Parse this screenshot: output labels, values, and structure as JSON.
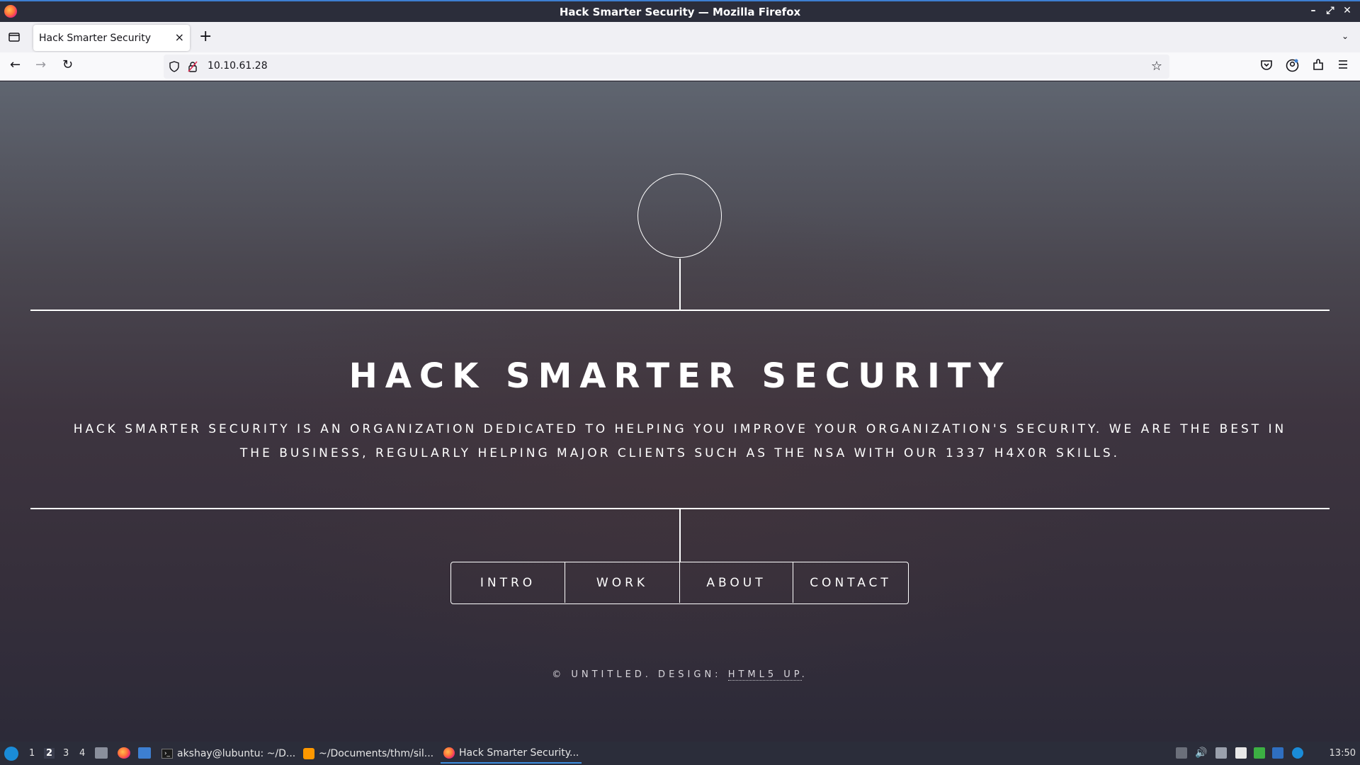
{
  "window": {
    "title": "Hack Smarter Security — Mozilla Firefox"
  },
  "tabs": [
    {
      "label": "Hack Smarter Security",
      "active": true
    }
  ],
  "navbar": {
    "url": "10.10.61.28"
  },
  "site": {
    "title": "HACK SMARTER SECURITY",
    "description": "Hack Smarter Security is an organization dedicated to helping you improve your organization's security. We are the best in the business, regularly helping major clients such as the NSA with our 1337 H4x0r skills.",
    "nav": [
      "INTRO",
      "WORK",
      "ABOUT",
      "CONTACT"
    ],
    "footer_prefix": "© UNTITLED. DESIGN: ",
    "footer_link": "HTML5 UP",
    "footer_suffix": "."
  },
  "taskbar": {
    "workspaces": [
      "1",
      "2",
      "3",
      "4"
    ],
    "active_workspace": "2",
    "tasks": [
      {
        "label": "akshay@lubuntu: ~/D...",
        "icon": "terminal-icon"
      },
      {
        "label": "~/Documents/thm/sil...",
        "icon": "sublime-text-icon"
      },
      {
        "label": "Hack Smarter Security...",
        "icon": "firefox-icon",
        "active": true
      }
    ],
    "clock": "13:50"
  },
  "colors": {
    "titlebar": "#2b2d3a",
    "accent": "#3d7fd1",
    "page_text": "#ffffff"
  }
}
